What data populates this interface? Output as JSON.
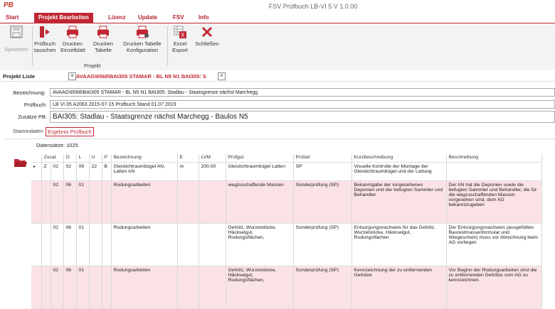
{
  "app": {
    "logo": "PB",
    "title": "FSV Prüfbuch LB-VI 5 V 1.0.00"
  },
  "menu": [
    "Start",
    "Projekt Bearbeiten",
    "Lizenz",
    "Update",
    "FSV",
    "Info"
  ],
  "ribbon": {
    "save": "Speichern",
    "swap": "Prüfbuch tauschen",
    "print_single": "Drucken Einzelblatt",
    "print_table": "Drucken Tabelle",
    "print_config": "Drucken Tabelle Konfiguration",
    "group_label": "Projekt",
    "excel": "Excel Export",
    "close": "Schließen"
  },
  "project_list": {
    "label": "Projekt Liste",
    "doc_tab": "AVAAG\\6568\\BAI305 STAMAR - BL N5 N1 BAI305: S"
  },
  "fields": {
    "bezeichnung_label": "Bezeichnung:",
    "bezeichnung_value": "AVAAG\\6568\\BAI305 STAMAR - BL N5 N1 BAI305: Stadlau - Staatsgrenze nächst Marchegg",
    "pruefbuch_label": "Prüfbuch:",
    "pruefbuch_value": "LB VI 05 A2063 2015-07-15 Prüfbuch Stand 01.07.2019",
    "zusatz_label": "Zusätze PB:",
    "zusatz_value": "BAI305: Stadlau - Staatsgrenze nächst Marchegg - Baulos N5"
  },
  "subtabs": {
    "stammdaten": "Stammdaten",
    "ergebnis": "Ergebnis Prüfbuch"
  },
  "grid": {
    "records_label": "Datensätze: 1025",
    "headers": [
      "Zusat",
      "O",
      "L",
      "U",
      "P",
      "",
      "Bezeichnung",
      "E",
      "LVM",
      "Prüfgut",
      "Prüfart",
      "Kurzbeschreibung",
      "Beschreibung"
    ],
    "rows": [
      {
        "c0": "Z",
        "c1": "02",
        "c2": "02",
        "c3": "09",
        "c4": "22",
        "c5": "B",
        "c6": "Gleislichtraumbügel AN, Latten AN",
        "c7": "m",
        "c8": "200.00",
        "c9": "Gleislichtraumbügel Latten",
        "c10": "SP",
        "c11": "Visuelle Kontrolle der Montage der Gleislichtraumbügel und der Lattung",
        "c12": ""
      },
      {
        "c0": "",
        "c1": "02",
        "c2": "06",
        "c3": "01",
        "c4": "",
        "c5": "",
        "c6": "Rodungsarbeiten",
        "c7": "",
        "c8": "",
        "c9": "wegzuschaffende Massen",
        "c10": "Sonderprüfung (SP)",
        "c11": "Bekanntgabe der vorgesehenen Deponien und der befugten Sammler und Behandler",
        "c12": "Der AN hat die Deponien sowie die befugten Sammler und Behandler, die für die wegzuschaffenden Massen vorgesehen sind, dem AG bekanntzugeben"
      },
      {
        "c0": "",
        "c1": "02",
        "c2": "06",
        "c3": "01",
        "c4": "",
        "c5": "",
        "c6": "Rodungsarbeiten",
        "c7": "",
        "c8": "",
        "c9": "Gehölz, Wurzelstöcke, Häckselgut, Rodungsflächen,",
        "c10": "Sonderprüfung (SP)",
        "c11": "Entsorgungsnachweis für das Gehölz, Wurzelstöcke, Häckselgut, Rodungsflächen",
        "c12": "Der Entsorgungsnachweis (ausgefülltes Baurestmassenformular und Wiegeschein) muss vor Abrechnung beim AG vorliegen"
      },
      {
        "c0": "",
        "c1": "02",
        "c2": "06",
        "c3": "01",
        "c4": "",
        "c5": "",
        "c6": "Rodungsarbeiten",
        "c7": "",
        "c8": "",
        "c9": "Gehölz, Wurzelstöcke, Häckselgut, Rodungsflächen,",
        "c10": "Sonderprüfung (SP)",
        "c11": "Kennzeichnung der zu entfernenden Gehölze",
        "c12": "Vor Beginn der Rodungsarbeiten sind die zu entfernenden Gehölze vom AG zu kennzeichnen."
      }
    ]
  },
  "colors": {
    "accent": "#c12733",
    "pink_row": "#fbe3e5"
  }
}
